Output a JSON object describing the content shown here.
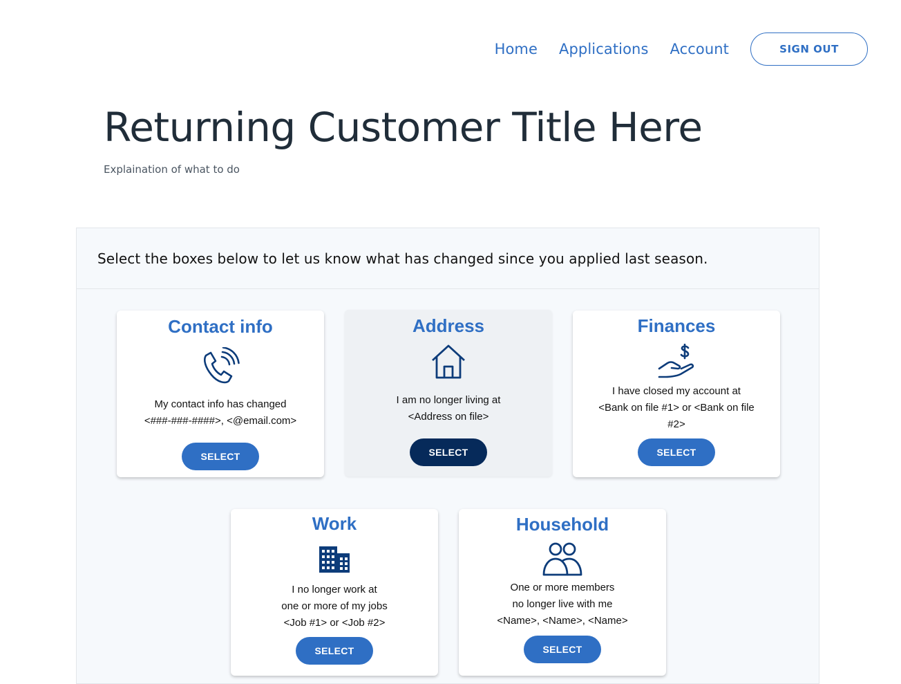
{
  "nav": {
    "home": "Home",
    "applications": "Applications",
    "account": "Account",
    "sign_out": "SIGN OUT"
  },
  "header": {
    "title": "Returning Customer Title Here",
    "subtitle": "Explaination of what to do"
  },
  "panel": {
    "prompt": "Select the boxes below to let us know what has changed since you applied last season."
  },
  "colors": {
    "accent": "#2f6fc4",
    "dark_button": "#062a5a",
    "icon": "#0d3c7a"
  },
  "cards": [
    {
      "title": "Contact info",
      "icon": "phone-ringing-icon",
      "lines": [
        "My contact info has changed",
        "<###-###-####>, <@email.com>"
      ],
      "button": "SELECT"
    },
    {
      "title": "Address",
      "icon": "house-icon",
      "lines": [
        "I am no longer living at",
        "<Address on file>"
      ],
      "button": "SELECT",
      "state": "selected"
    },
    {
      "title": "Finances",
      "icon": "hand-dollar-icon",
      "lines": [
        "I have closed my account at",
        "<Bank on file #1> or <Bank on file",
        "#2>"
      ],
      "button": "SELECT"
    },
    {
      "title": "Work",
      "icon": "office-building-icon",
      "lines": [
        "I no longer work at",
        "one or more of my jobs",
        "<Job #1> or <Job #2>"
      ],
      "button": "SELECT"
    },
    {
      "title": "Household",
      "icon": "people-icon",
      "lines": [
        "One or more members",
        "no longer live with me",
        "<Name>, <Name>, <Name>"
      ],
      "button": "SELECT"
    }
  ]
}
